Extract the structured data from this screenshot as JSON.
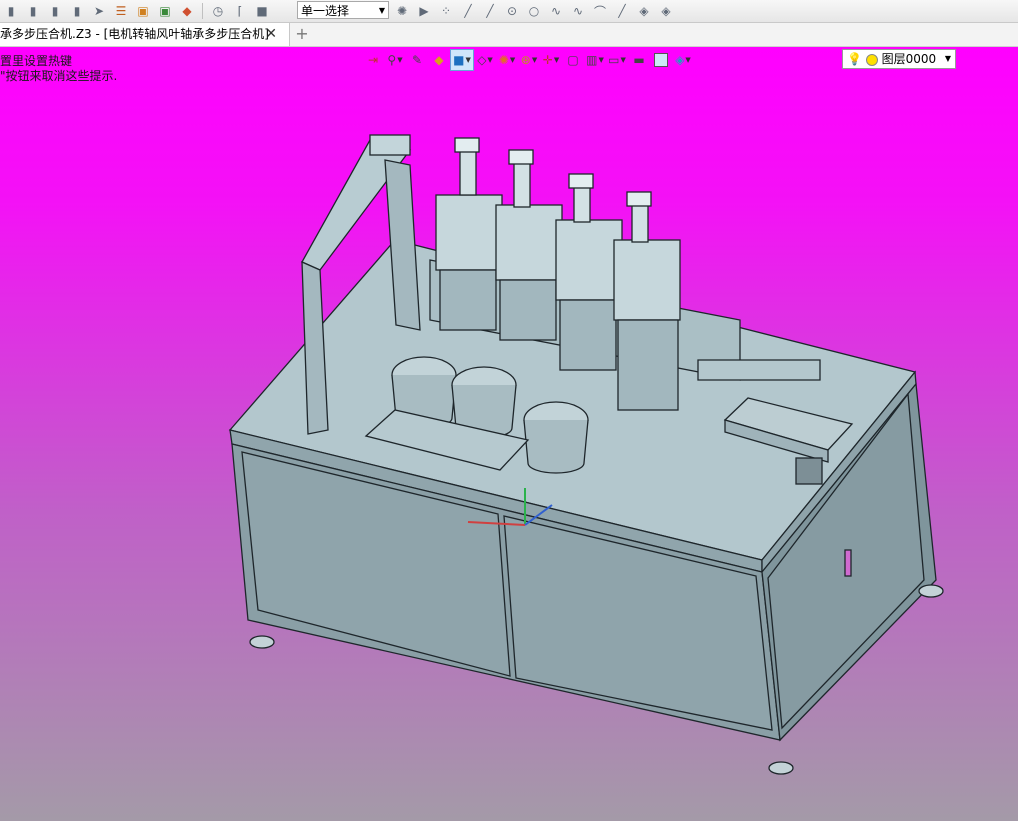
{
  "toolbar": {
    "select_mode": "单一选择"
  },
  "tabs": {
    "active_label": "承多步压合机.Z3 - [电机转轴风叶轴承多步压合机]",
    "close_glyph": "✕",
    "add_glyph": "+"
  },
  "hints": {
    "line1": "置里设置热键",
    "line2": "\"按钮来取消这些提示."
  },
  "view_toolbar": {
    "layer_value": "图层0000"
  },
  "colors": {
    "background_top": "#ff00ff",
    "background_bottom": "#a49aa8",
    "model_fill": "#a9bcc3",
    "model_edge": "#1e262b"
  }
}
